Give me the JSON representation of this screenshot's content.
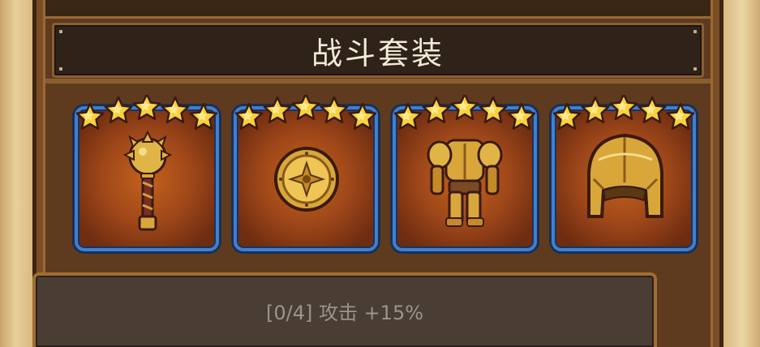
{
  "panel": {
    "title": "战斗套装"
  },
  "items": [
    {
      "name": "mace",
      "icon": "mace-icon",
      "stars": 5
    },
    {
      "name": "shield",
      "icon": "round-shield-icon",
      "stars": 5
    },
    {
      "name": "armor",
      "icon": "armor-icon",
      "stars": 5
    },
    {
      "name": "helmet",
      "icon": "helmet-icon",
      "stars": 5
    }
  ],
  "set_bonus": {
    "text": "[0/4] 攻击 +15%"
  },
  "colors": {
    "card_border": "#3f7fd0",
    "card_bg": "#a0481a",
    "star": "#f7d23c",
    "gold": "#d9a63a",
    "title_text": "#f3ead8",
    "bonus_text": "#9b948c"
  }
}
